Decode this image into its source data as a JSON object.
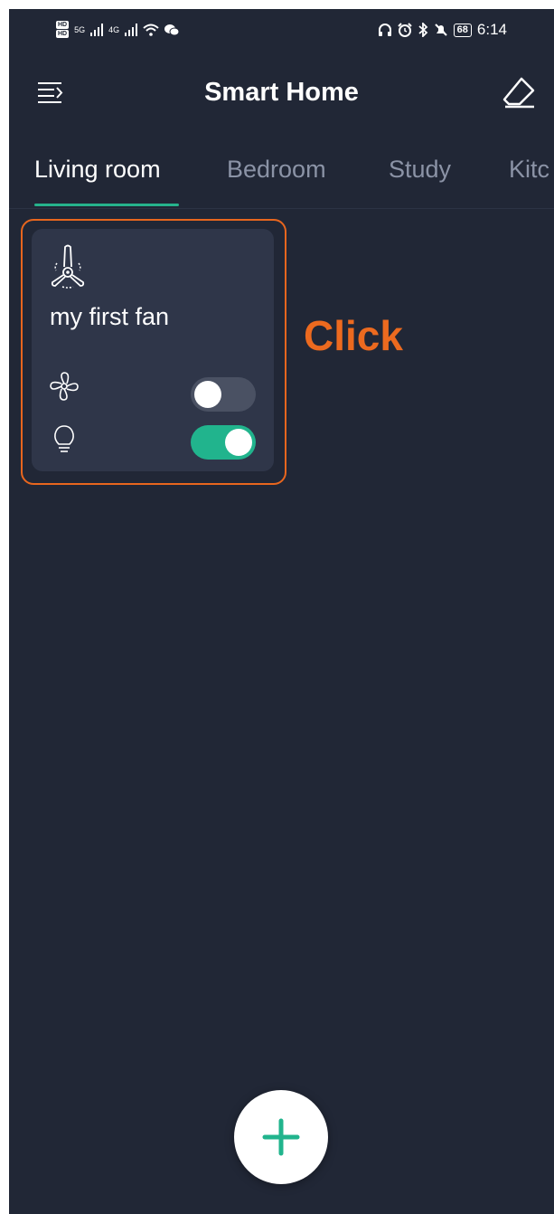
{
  "status_bar": {
    "hd_badges": [
      "HD",
      "HD"
    ],
    "signal_1": "5G",
    "signal_2": "4G",
    "battery": "68",
    "time": "6:14"
  },
  "header": {
    "title": "Smart Home",
    "menu_icon": "menu-icon",
    "eraser_icon": "eraser-icon"
  },
  "tabs": [
    {
      "label": "Living room",
      "active": true
    },
    {
      "label": "Bedroom",
      "active": false
    },
    {
      "label": "Study",
      "active": false
    },
    {
      "label": "Kitc",
      "active": false
    }
  ],
  "device_card": {
    "icon": "ceiling-fan-icon",
    "name": "my first fan",
    "controls": [
      {
        "icon": "fan-icon",
        "state": false
      },
      {
        "icon": "bulb-icon",
        "state": true
      }
    ]
  },
  "annotation": {
    "label": "Click"
  },
  "fab": {
    "icon": "plus-icon"
  },
  "colors": {
    "background": "#212736",
    "card": "#2f3649",
    "accent": "#21b48d",
    "annotation": "#ec6a1f"
  }
}
